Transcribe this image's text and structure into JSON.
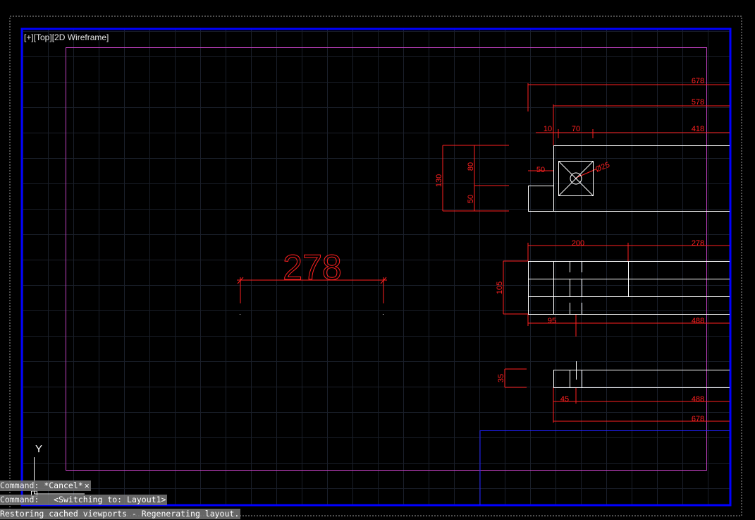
{
  "viewport": {
    "label": "[+][Top][2D Wireframe]"
  },
  "ucs": {
    "y_axis_label": "Y"
  },
  "command_history": [
    {
      "prefix": "Command: ",
      "text": "*Cancel*"
    },
    {
      "prefix": "Command:   ",
      "text": "<Switching to: Layout1>"
    },
    {
      "prefix": "",
      "text": "Restoring cached viewports - Regenerating layout."
    }
  ],
  "colors": {
    "background": "#000000",
    "grid": "#1a1f2a",
    "viewport_border": "#0000ff",
    "layout_border": "#c040c0",
    "dimension": "#ff2020",
    "geometry": "#ffffff"
  },
  "dimensions": {
    "big_278": "278",
    "d678_top": "678",
    "d578": "578",
    "d10": "10",
    "d70": "70",
    "d418": "418",
    "d130": "130",
    "d80": "80",
    "d50_v": "50",
    "d50_h": "50",
    "d25": "Ø25",
    "d200": "200",
    "d278_right": "278",
    "d105": "105",
    "d95": "95",
    "d488_a": "488",
    "d35": "35",
    "d45": "45",
    "d488_b": "488",
    "d678_bottom": "678"
  }
}
